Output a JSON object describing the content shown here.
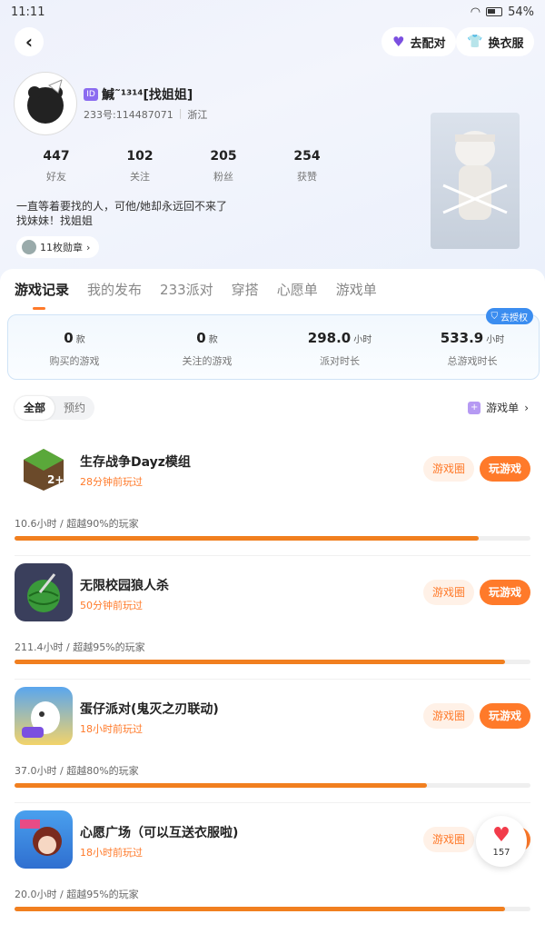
{
  "status": {
    "time": "11:11",
    "battery": "54%"
  },
  "nav": {
    "back": "‹",
    "match_label": "去配对",
    "outfit_label": "换衣服"
  },
  "profile": {
    "id_badge": "ID",
    "name": "鰔˜¹³¹⁴[找姐姐]",
    "account": "233号:114487071",
    "region": "浙江",
    "bio_line1": "一直等着要找的人，可他/她却永远回不来了",
    "bio_line2": "找妹妹！找姐姐",
    "medal": "11枚勋章"
  },
  "stats": [
    {
      "num": "447",
      "label": "好友"
    },
    {
      "num": "102",
      "label": "关注"
    },
    {
      "num": "205",
      "label": "粉丝"
    },
    {
      "num": "254",
      "label": "获赞"
    }
  ],
  "tabs": [
    "游戏记录",
    "我的发布",
    "233派对",
    "穿搭",
    "心愿单",
    "游戏单"
  ],
  "summary": {
    "auth_label": "去授权",
    "items": [
      {
        "value": "0",
        "unit": "款",
        "label": "购买的游戏"
      },
      {
        "value": "0",
        "unit": "款",
        "label": "关注的游戏"
      },
      {
        "value": "298.0",
        "unit": "小时",
        "label": "派对时长"
      },
      {
        "value": "533.9",
        "unit": "小时",
        "label": "总游戏时长"
      }
    ]
  },
  "filter": {
    "all": "全部",
    "reserve": "预约",
    "gamelist": "游戏单"
  },
  "games": [
    {
      "title": "生存战争Dayz模组",
      "played": "28分钟前玩过",
      "stat": "10.6小时 / 超越90%的玩家",
      "progress": 0.9,
      "icon_color": "#5aa83a",
      "icon_glyph": "■"
    },
    {
      "title": "无限校园狼人杀",
      "played": "50分钟前玩过",
      "stat": "211.4小时 / 超越95%的玩家",
      "progress": 0.95,
      "icon_color": "#3a3f5c",
      "icon_glyph": "●"
    },
    {
      "title": "蛋仔派对(鬼灭之刃联动)",
      "played": "18小时前玩过",
      "stat": "37.0小时 / 超越80%的玩家",
      "progress": 0.8,
      "icon_color": "#4b8fe0",
      "icon_glyph": "◆"
    },
    {
      "title": "心愿广场（可以互送衣服啦)",
      "played": "18小时前玩过",
      "stat": "20.0小时 / 超越95%的玩家",
      "progress": 0.95,
      "icon_color": "#3c8de0",
      "icon_glyph": "✿"
    }
  ],
  "game_buttons": {
    "circle": "游戏圈",
    "play": "玩游戏"
  },
  "like": {
    "count": "157"
  }
}
